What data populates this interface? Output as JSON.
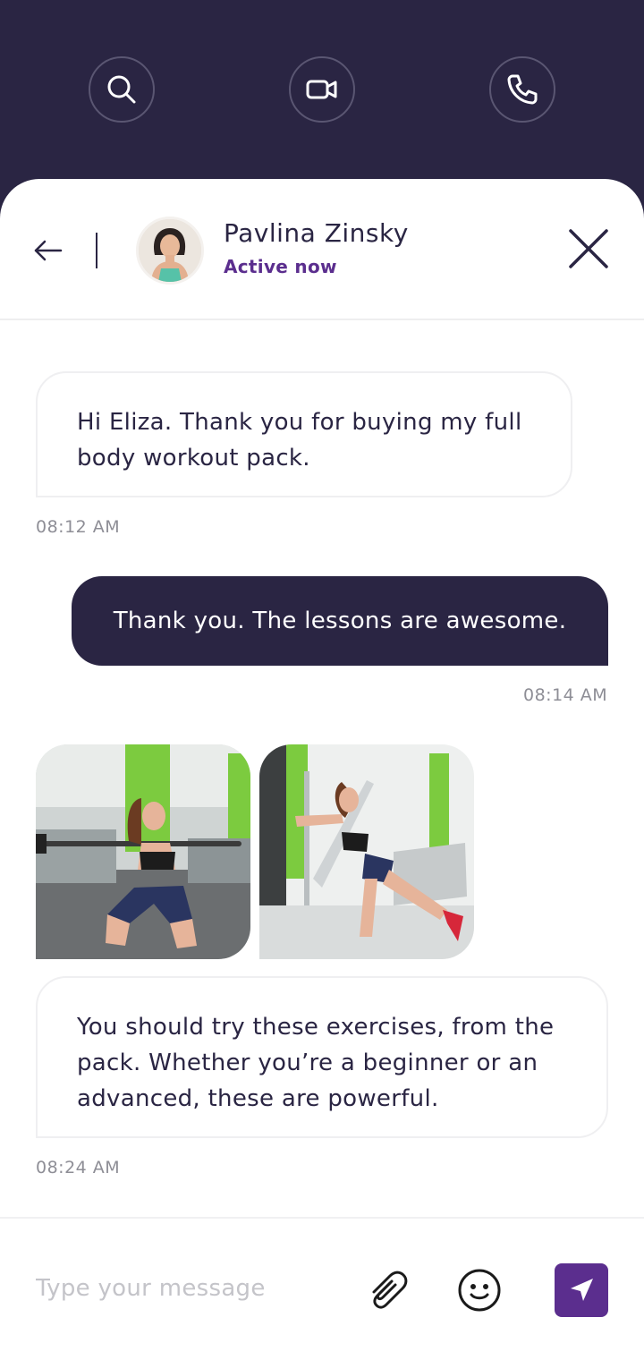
{
  "theme": {
    "primary_dark": "#2a2543",
    "accent": "#5b2e8e",
    "muted_text": "#8e8e96"
  },
  "top_actions": [
    {
      "name": "search",
      "icon": "search-icon"
    },
    {
      "name": "video-call",
      "icon": "video-camera-icon"
    },
    {
      "name": "voice-call",
      "icon": "phone-icon"
    }
  ],
  "header": {
    "back_icon": "arrow-left-icon",
    "contact_name": "Pavlina Zinsky",
    "status": "Active now",
    "close_icon": "close-icon"
  },
  "messages": [
    {
      "direction": "incoming",
      "type": "text",
      "text": "Hi Eliza. Thank you for buying my full body workout pack.",
      "time": "08:12 AM"
    },
    {
      "direction": "outgoing",
      "type": "text",
      "text": "Thank you. The lessons are awesome.",
      "time": "08:14 AM"
    },
    {
      "direction": "incoming",
      "type": "images",
      "images": [
        "squat-photo",
        "kickback-photo"
      ]
    },
    {
      "direction": "incoming",
      "type": "text",
      "text": "You should try these exercises, from the pack. Whether you’re a beginner or an advanced, these are powerful.",
      "time": "08:24 AM"
    }
  ],
  "composer": {
    "placeholder": "Type your message",
    "value": "",
    "attach_icon": "paperclip-icon",
    "emoji_icon": "smiley-icon",
    "send_icon": "send-icon"
  }
}
